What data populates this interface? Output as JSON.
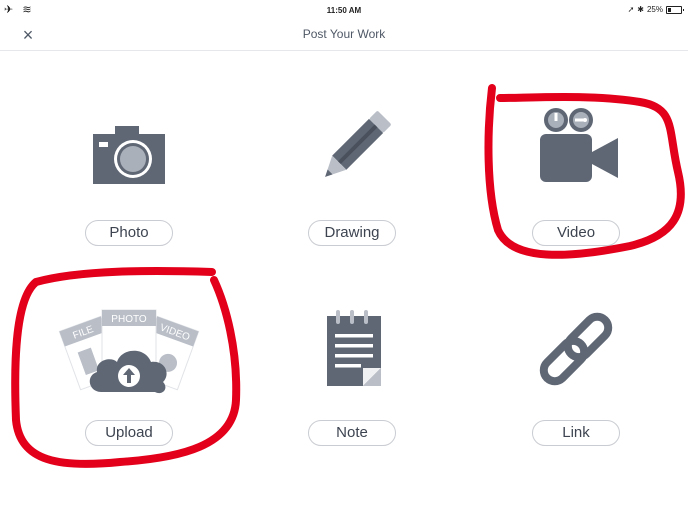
{
  "status": {
    "left": "✈ ︎ ≋",
    "time": "11:50 AM",
    "battery": "25%"
  },
  "nav": {
    "close": "×",
    "title": "Post Your Work"
  },
  "options": {
    "photo": {
      "label": "Photo",
      "icon": "camera-icon"
    },
    "drawing": {
      "label": "Drawing",
      "icon": "pencil-icon"
    },
    "video": {
      "label": "Video",
      "icon": "video-camera-icon"
    },
    "upload": {
      "label": "Upload",
      "icon": "cloud-upload-icon",
      "tags": {
        "file": "FILE",
        "photo": "PHOTO",
        "video": "VIDEO"
      }
    },
    "note": {
      "label": "Note",
      "icon": "notepad-icon"
    },
    "link": {
      "label": "Link",
      "icon": "chain-link-icon"
    }
  },
  "colors": {
    "icon": "#5f6775",
    "icon_light": "#b9bec7",
    "annotation": "#e3001b"
  }
}
